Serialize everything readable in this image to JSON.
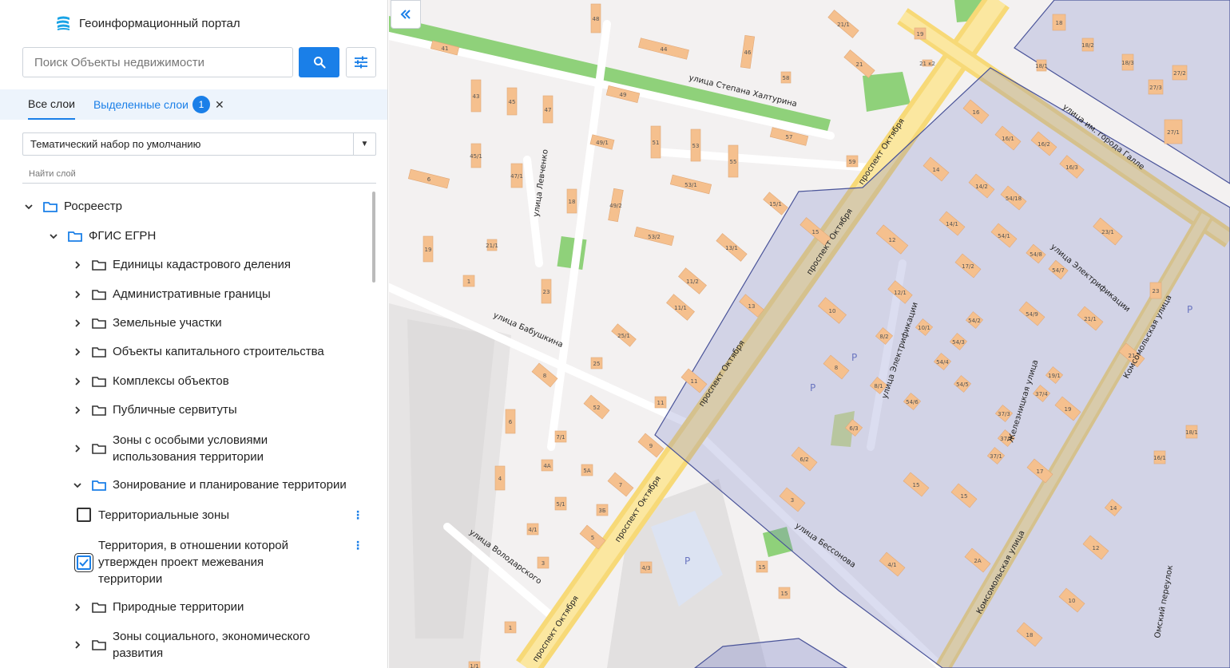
{
  "header": {
    "title": "Геоинформационный портал"
  },
  "search": {
    "placeholder": "Поиск Объекты недвижимости"
  },
  "tabs": {
    "all_label": "Все слои",
    "selected_label": "Выделенные слои",
    "selected_count": "1"
  },
  "theme_select": {
    "value": "Тематический набор по умолчанию"
  },
  "layer_search": {
    "placeholder": "Найти слой"
  },
  "tree": {
    "root": "Росреестр",
    "child": "ФГИС ЕГРН",
    "folders": [
      "Единицы кадастрового деления",
      "Административные границы",
      "Земельные участки",
      "Объекты капитального строительства",
      "Комплексы объектов",
      "Публичные сервитуты"
    ],
    "zones_folder_line1": "Зоны с особыми условиями",
    "zones_folder_line2": "использования территории",
    "zoning_folder": "Зонирование и планирование территории",
    "layer_terr_zones": "Территориальные зоны",
    "layer_mezh_line1": "Территория, в отношении которой",
    "layer_mezh_line2": "утвержден проект межевания",
    "layer_mezh_line3": "территории",
    "natural_folder": "Природные территории",
    "social_line1": "Зоны социального, экономического",
    "social_line2": "развития"
  },
  "map": {
    "streets": {
      "khalturina": "улица Степана Халтурина",
      "oktyabrya1": "проспект Октября",
      "oktyabrya2": "проспект Октября",
      "oktyabrya3": "проспект Октября",
      "oktyabrya4": "проспект Октября",
      "oktyabrya5": "проспект Октября",
      "galle": "улица им. города Галле",
      "levchenko": "улица Левченко",
      "babushkina": "улица Бабушкина",
      "elektrif1": "улица Электрификации",
      "elektrif2": "улица Электрификации",
      "komsom1": "Комсомольская улица",
      "komsom2": "Комсомольская улица",
      "zheleznitskaya": "Железницкая улица",
      "bessonova": "улица Бессонова",
      "volodarskogo": "улица Володарского",
      "omsky": "Омский переулок"
    },
    "parking": "P",
    "buildings": [
      {
        "n": "41"
      },
      {
        "n": "48"
      },
      {
        "n": "44"
      },
      {
        "n": "46"
      },
      {
        "n": "21/1"
      },
      {
        "n": "19"
      },
      {
        "n": "21 к2"
      },
      {
        "n": "43"
      },
      {
        "n": "45"
      },
      {
        "n": "47"
      },
      {
        "n": "49"
      },
      {
        "n": "58"
      },
      {
        "n": "21"
      },
      {
        "n": "18"
      },
      {
        "n": "18/2"
      },
      {
        "n": "18/3"
      },
      {
        "n": "18/1"
      },
      {
        "n": "27/2"
      },
      {
        "n": "27/3"
      },
      {
        "n": "27/1"
      },
      {
        "n": "51"
      },
      {
        "n": "53"
      },
      {
        "n": "55"
      },
      {
        "n": "57"
      },
      {
        "n": "59"
      },
      {
        "n": "16"
      },
      {
        "n": "16/1"
      },
      {
        "n": "16/2"
      },
      {
        "n": "16/3"
      },
      {
        "n": "45/1"
      },
      {
        "n": "47/1"
      },
      {
        "n": "49/1"
      },
      {
        "n": "49/2"
      },
      {
        "n": "53/1"
      },
      {
        "n": "15/1"
      },
      {
        "n": "14"
      },
      {
        "n": "14/2"
      },
      {
        "n": "54/18"
      },
      {
        "n": "6"
      },
      {
        "n": "18"
      },
      {
        "n": "53/2"
      },
      {
        "n": "13/1"
      },
      {
        "n": "15"
      },
      {
        "n": "14/1"
      },
      {
        "n": "54/1"
      },
      {
        "n": "23/1"
      },
      {
        "n": "19"
      },
      {
        "n": "21/1"
      },
      {
        "n": "11/2"
      },
      {
        "n": "12"
      },
      {
        "n": "17/2"
      },
      {
        "n": "54/8"
      },
      {
        "n": "54/7"
      },
      {
        "n": "1"
      },
      {
        "n": "23"
      },
      {
        "n": "11/1"
      },
      {
        "n": "13"
      },
      {
        "n": "12/1"
      },
      {
        "n": "54/9"
      },
      {
        "n": "21/1"
      },
      {
        "n": "23"
      },
      {
        "n": "10"
      },
      {
        "n": "25/1"
      },
      {
        "n": "10/1"
      },
      {
        "n": "54/3"
      },
      {
        "n": "54/2"
      },
      {
        "n": "8/2"
      },
      {
        "n": "8"
      },
      {
        "n": "21"
      },
      {
        "n": "25"
      },
      {
        "n": "11"
      },
      {
        "n": "54/4"
      },
      {
        "n": "54/5"
      },
      {
        "n": "19/1"
      },
      {
        "n": "8"
      },
      {
        "n": "8/1"
      },
      {
        "n": "52"
      },
      {
        "n": "11"
      },
      {
        "n": "54/6"
      },
      {
        "n": "37/4"
      },
      {
        "n": "37/3"
      },
      {
        "n": "19"
      },
      {
        "n": "6"
      },
      {
        "n": "9"
      },
      {
        "n": "6/3"
      },
      {
        "n": "37/2"
      },
      {
        "n": "7/1"
      },
      {
        "n": "6/2"
      },
      {
        "n": "37/1"
      },
      {
        "n": "17"
      },
      {
        "n": "18/1"
      },
      {
        "n": "4A"
      },
      {
        "n": "5A"
      },
      {
        "n": "4"
      },
      {
        "n": "7"
      },
      {
        "n": "15"
      },
      {
        "n": "15"
      },
      {
        "n": "16/1"
      },
      {
        "n": "3"
      },
      {
        "n": "14"
      },
      {
        "n": "5/1"
      },
      {
        "n": "3Б"
      },
      {
        "n": "4/1"
      },
      {
        "n": "5"
      },
      {
        "n": "12"
      },
      {
        "n": "3"
      },
      {
        "n": "15"
      },
      {
        "n": "4/3"
      },
      {
        "n": "4/1"
      },
      {
        "n": "2A"
      },
      {
        "n": "15"
      },
      {
        "n": "10"
      },
      {
        "n": "1"
      },
      {
        "n": "18"
      },
      {
        "n": "1/1"
      }
    ]
  }
}
